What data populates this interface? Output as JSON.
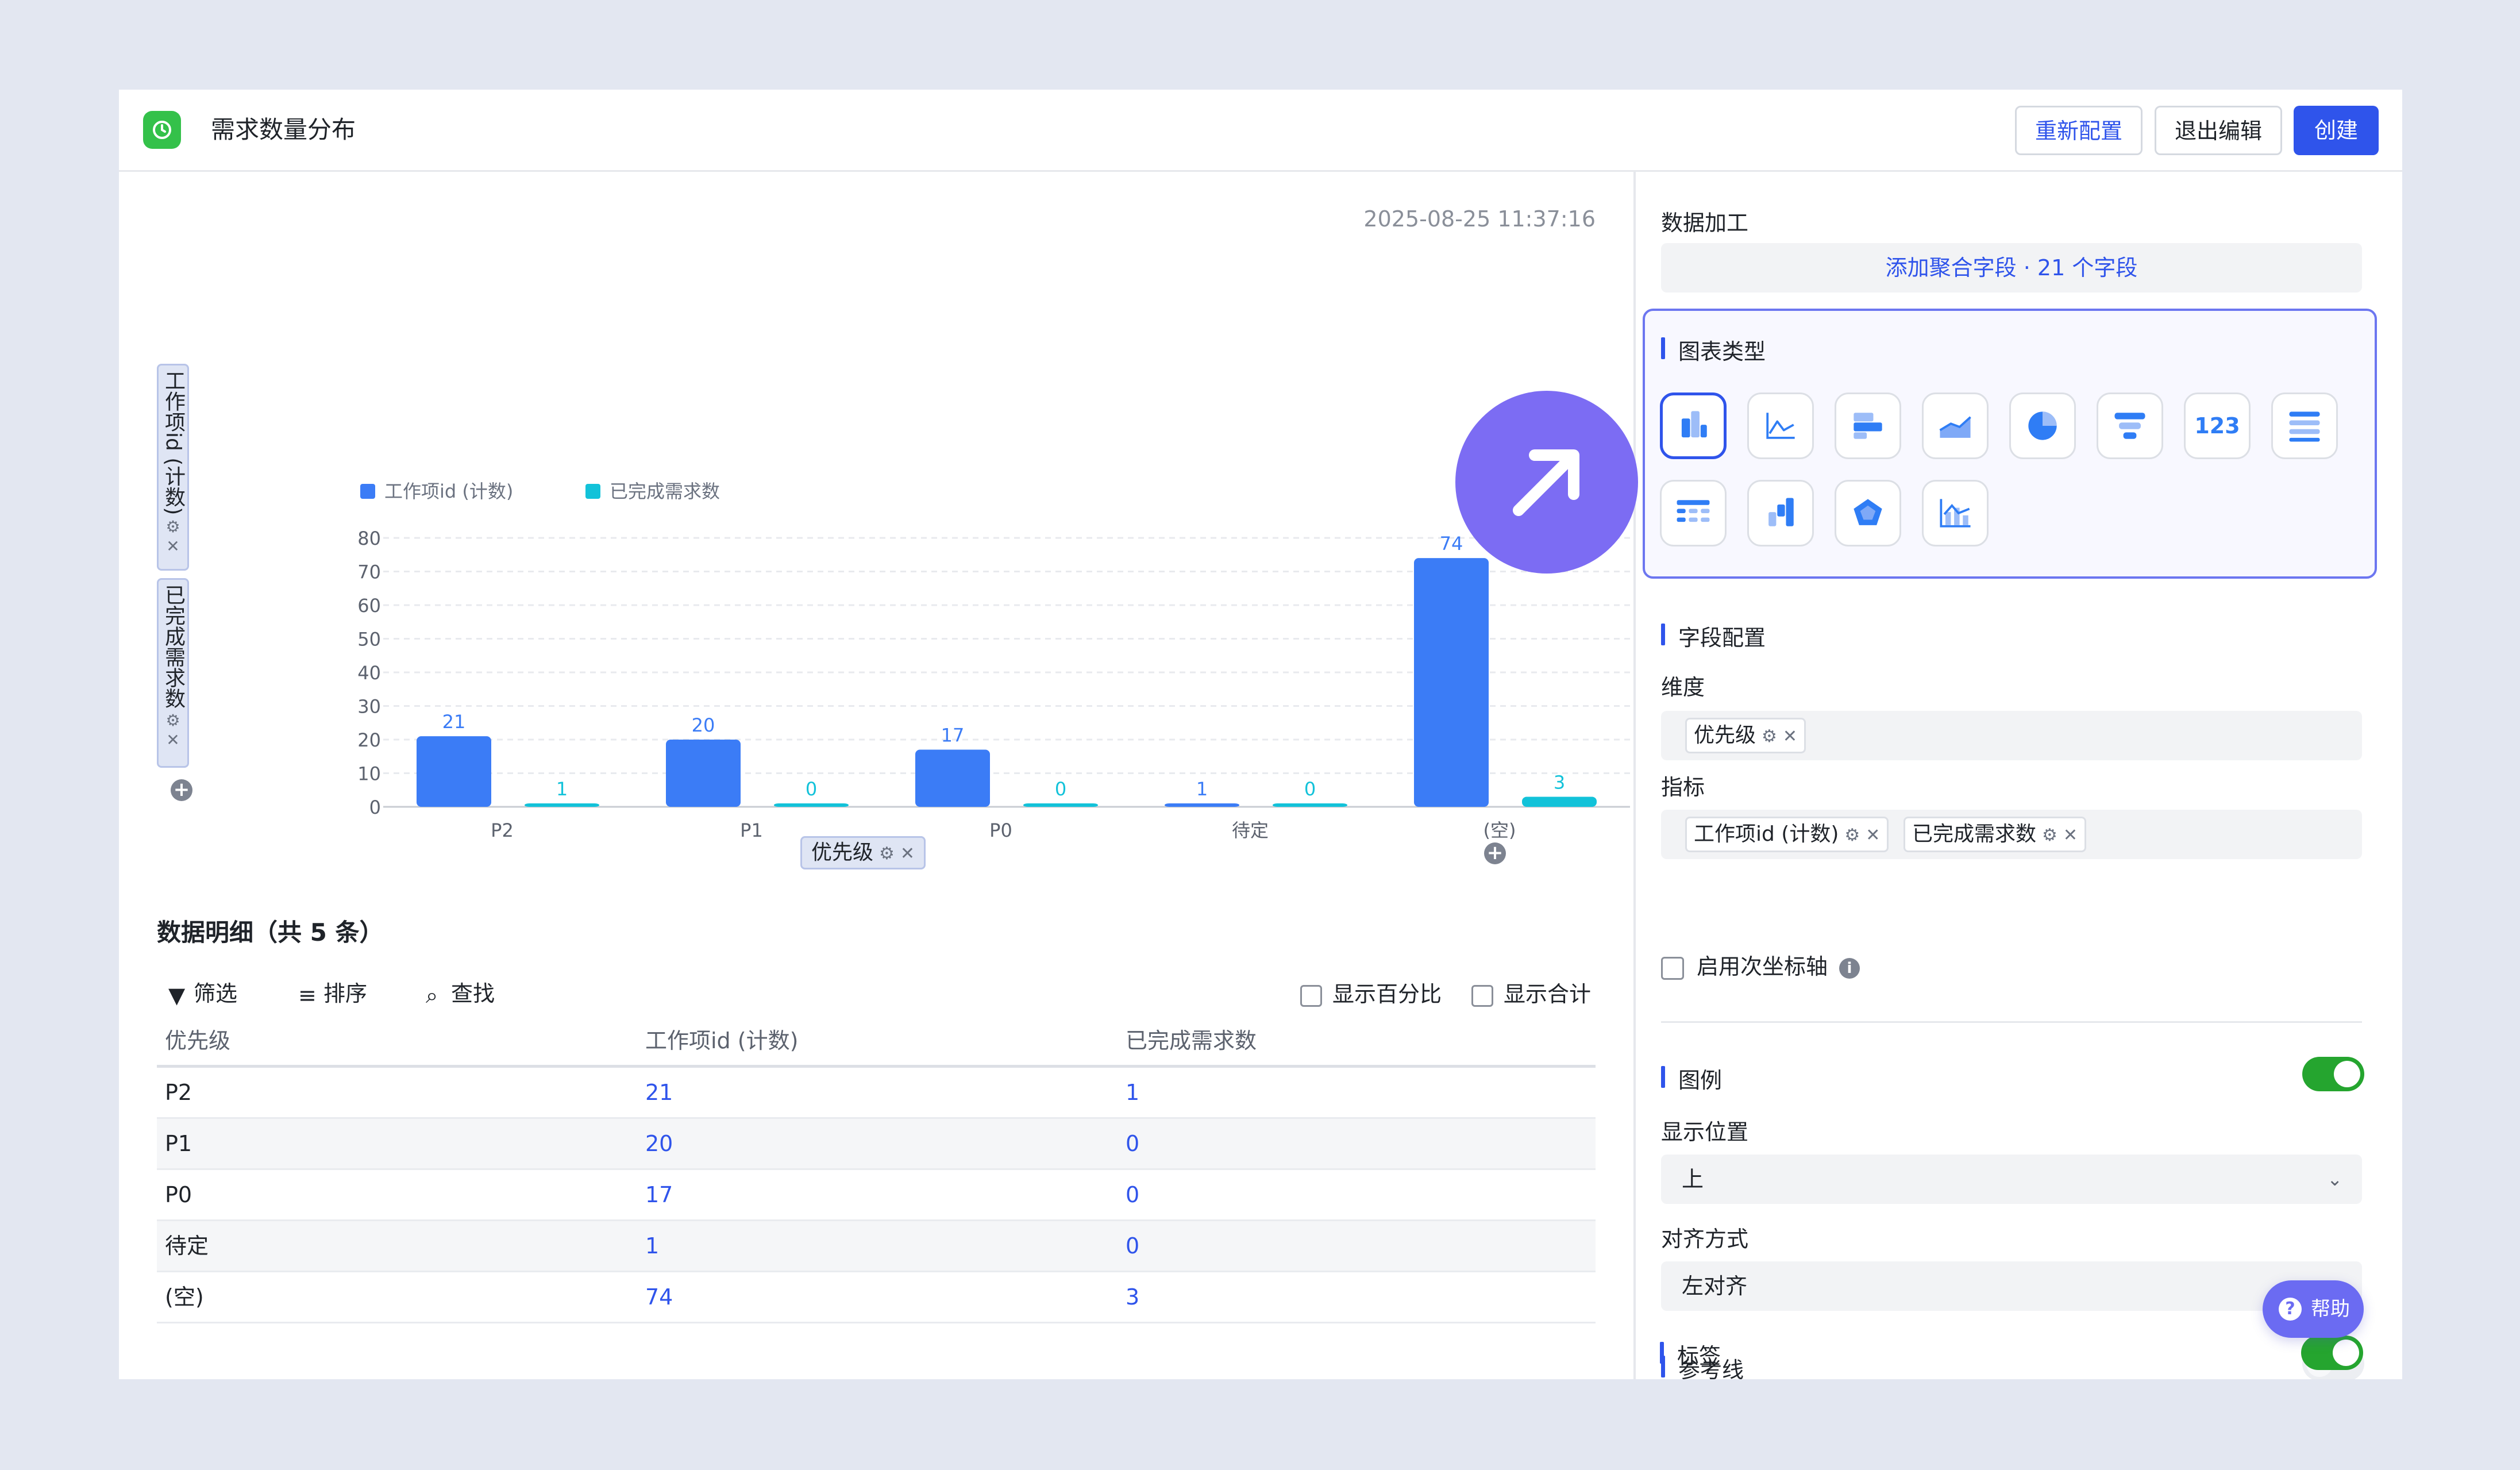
{
  "header": {
    "title": "需求数量分布",
    "reconfigure_label": "重新配置",
    "exit_edit_label": "退出编辑",
    "create_label": "创建"
  },
  "chart_panel": {
    "timestamp": "2025-08-25 11:37:16",
    "y_field_1": "工作项id (计数)",
    "y_field_2": "已完成需求数",
    "x_field": "优先级"
  },
  "chart_data": {
    "type": "bar",
    "categories": [
      "P2",
      "P1",
      "P0",
      "待定",
      "(空)"
    ],
    "series": [
      {
        "name": "工作项id (计数)",
        "values": [
          21,
          20,
          17,
          1,
          74
        ],
        "color": "#3b7cf6"
      },
      {
        "name": "已完成需求数",
        "values": [
          1,
          0,
          0,
          0,
          3
        ],
        "color": "#12c2d9"
      }
    ],
    "ylim": [
      0,
      80
    ],
    "yticks": [
      0,
      10,
      20,
      30,
      40,
      50,
      60,
      70,
      80
    ],
    "grid": true,
    "legend_position": "top-left",
    "data_labels": true
  },
  "detail": {
    "title": "数据明细（共 5 条）",
    "filter_label": "筛选",
    "sort_label": "排序",
    "find_label": "查找",
    "show_percent_label": "显示百分比",
    "show_total_label": "显示合计",
    "columns": [
      "优先级",
      "工作项id (计数)",
      "已完成需求数"
    ],
    "rows": [
      [
        "P2",
        "21",
        "1"
      ],
      [
        "P1",
        "20",
        "0"
      ],
      [
        "P0",
        "17",
        "0"
      ],
      [
        "待定",
        "1",
        "0"
      ],
      [
        "(空)",
        "74",
        "3"
      ]
    ]
  },
  "config": {
    "data_processing_label": "数据加工",
    "add_agg_label": "添加聚合字段 · 21 个字段",
    "chart_type_label": "图表类型",
    "chart_types": [
      "bar-chart-icon",
      "line-chart-icon",
      "horizontal-bar-icon",
      "area-chart-icon",
      "pie-chart-icon",
      "funnel-icon",
      "number-card-icon",
      "list-table-icon",
      "pivot-table-icon",
      "waterfall-icon",
      "radar-icon",
      "combo-chart-icon"
    ],
    "number_card_text": "123",
    "field_config_label": "字段配置",
    "dimension_label": "维度",
    "dimension_tag": "优先级",
    "metric_label": "指标",
    "metric_tag_1": "工作项id (计数)",
    "metric_tag_2": "已完成需求数",
    "secondary_axis_label": "启用次坐标轴",
    "legend_label": "图例",
    "legend_enabled": true,
    "position_label": "显示位置",
    "position_value": "上",
    "align_label": "对齐方式",
    "align_value": "左对齐",
    "refline_label": "参考线",
    "refline_enabled": false,
    "label_label": "标签",
    "label_enabled": true
  },
  "help_label": "帮助",
  "colors": {
    "accent": "#2f54eb",
    "toggle_on": "#25a52f",
    "overlay": "#7c6cf3"
  }
}
